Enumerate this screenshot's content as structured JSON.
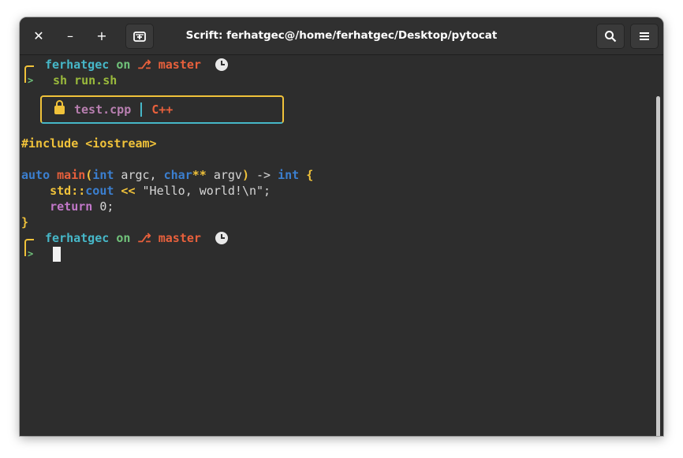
{
  "window": {
    "title": "Scrift: ferhatgec@/home/ferhatgec/Desktop/pytocat",
    "buttons": {
      "close": "✕",
      "minimize": "–",
      "maximize": "+",
      "search_icon": "search-icon",
      "menu_icon": "hamburger-menu-icon",
      "new_tab_icon": "new-tab-icon"
    }
  },
  "prompt": {
    "user": "ferhatgec",
    "on": "on",
    "branch_icon": "⎇",
    "branch": "master",
    "arrow": ">"
  },
  "command": "sh run.sh",
  "file_header": {
    "filename": "test.cpp",
    "language": "C++"
  },
  "code": {
    "include_directive": "#include",
    "include_target": "<iostream>",
    "l3": {
      "auto": "auto",
      "main": "main",
      "paren_open": "(",
      "int1": "int",
      "argc": " argc, ",
      "char": "char",
      "stars": "**",
      "argv": " argv",
      "paren_close": ")",
      "arrow": " -> ",
      "int2": "int",
      "brace": " {"
    },
    "l4": {
      "indent": "    ",
      "std": "std",
      "scope": "::",
      "cout": "cout",
      "op": " <<",
      "str": " \"Hello, world!\\n\";"
    },
    "l5": {
      "indent": "    ",
      "ret": "return",
      "val": " 0;"
    },
    "l6": "}"
  },
  "colors": {
    "user": "#46b7c8",
    "on": "#70c27a",
    "branch": "#e8603c",
    "command": "#9aba3c",
    "bracket": "#f0c23a",
    "keyword_blue": "#3b7fd0",
    "background": "#2d2d2d"
  }
}
